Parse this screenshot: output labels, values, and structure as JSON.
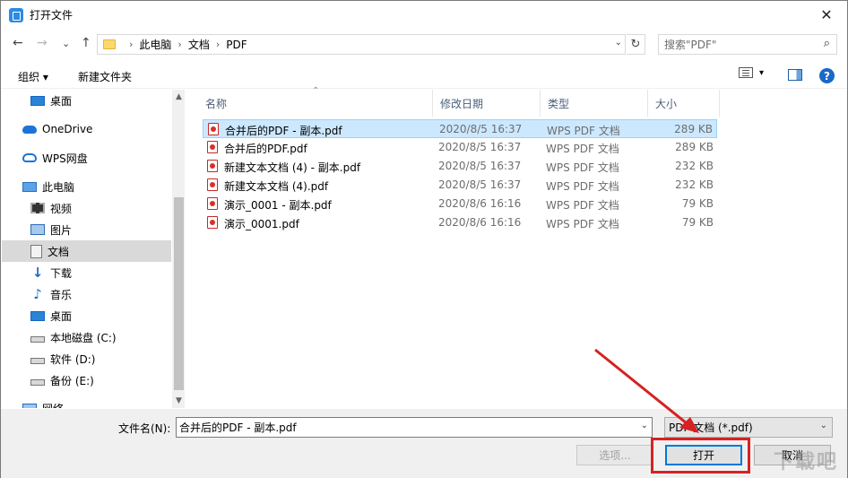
{
  "window": {
    "title": "打开文件",
    "close_label": "✕"
  },
  "nav": {
    "back": "←",
    "forward": "→",
    "recent": "⌄",
    "up": "↑"
  },
  "address": {
    "crumbs": [
      "此电脑",
      "文档",
      "PDF"
    ],
    "separator": "›",
    "dropdown": "⌄",
    "refresh": "↻"
  },
  "search": {
    "placeholder": "搜索\"PDF\"",
    "icon": "⌕"
  },
  "toolbar": {
    "organize_label": "组织 ▾",
    "new_folder_label": "新建文件夹",
    "help_label": "?",
    "view_dd": "▾"
  },
  "sidebar": {
    "items": [
      {
        "label": "桌面",
        "icon": "desktop-icon"
      },
      {
        "label": "OneDrive",
        "icon": "cloud-icon"
      },
      {
        "label": "WPS网盘",
        "icon": "wps-cloud-icon"
      },
      {
        "label": "此电脑",
        "icon": "pc-icon"
      },
      {
        "label": "视频",
        "icon": "video-icon"
      },
      {
        "label": "图片",
        "icon": "pictures-icon"
      },
      {
        "label": "文档",
        "icon": "documents-icon"
      },
      {
        "label": "下载",
        "icon": "download-icon"
      },
      {
        "label": "音乐",
        "icon": "music-icon"
      },
      {
        "label": "桌面",
        "icon": "desktop-icon"
      },
      {
        "label": "本地磁盘 (C:)",
        "icon": "drive-icon"
      },
      {
        "label": "软件 (D:)",
        "icon": "drive-icon"
      },
      {
        "label": "备份 (E:)",
        "icon": "drive-icon"
      },
      {
        "label": "网络",
        "icon": "network-icon"
      }
    ],
    "selected_index": 6
  },
  "columns": {
    "name": "名称",
    "modified": "修改日期",
    "type": "类型",
    "size": "大小"
  },
  "files": [
    {
      "name": "合并后的PDF - 副本.pdf",
      "modified": "2020/8/5 16:37",
      "type": "WPS PDF 文档",
      "size": "289 KB"
    },
    {
      "name": "合并后的PDF.pdf",
      "modified": "2020/8/5 16:37",
      "type": "WPS PDF 文档",
      "size": "289 KB"
    },
    {
      "name": "新建文本文档 (4) - 副本.pdf",
      "modified": "2020/8/5 16:37",
      "type": "WPS PDF 文档",
      "size": "232 KB"
    },
    {
      "name": "新建文本文档 (4).pdf",
      "modified": "2020/8/5 16:37",
      "type": "WPS PDF 文档",
      "size": "232 KB"
    },
    {
      "name": "演示_0001 - 副本.pdf",
      "modified": "2020/8/6 16:16",
      "type": "WPS PDF 文档",
      "size": "79 KB"
    },
    {
      "name": "演示_0001.pdf",
      "modified": "2020/8/6 16:16",
      "type": "WPS PDF 文档",
      "size": "79 KB"
    }
  ],
  "selected_file_index": 0,
  "bottom": {
    "filename_label": "文件名(N):",
    "filename_value": "合并后的PDF - 副本.pdf",
    "filetype_value": "PDF 文档 (*.pdf)",
    "options_label": "选项...",
    "open_label": "打开",
    "cancel_label": "取消"
  },
  "watermark": "下载吧",
  "colors": {
    "annotation": "#d62222",
    "selection": "#cce8ff",
    "accent": "#0078d7"
  }
}
